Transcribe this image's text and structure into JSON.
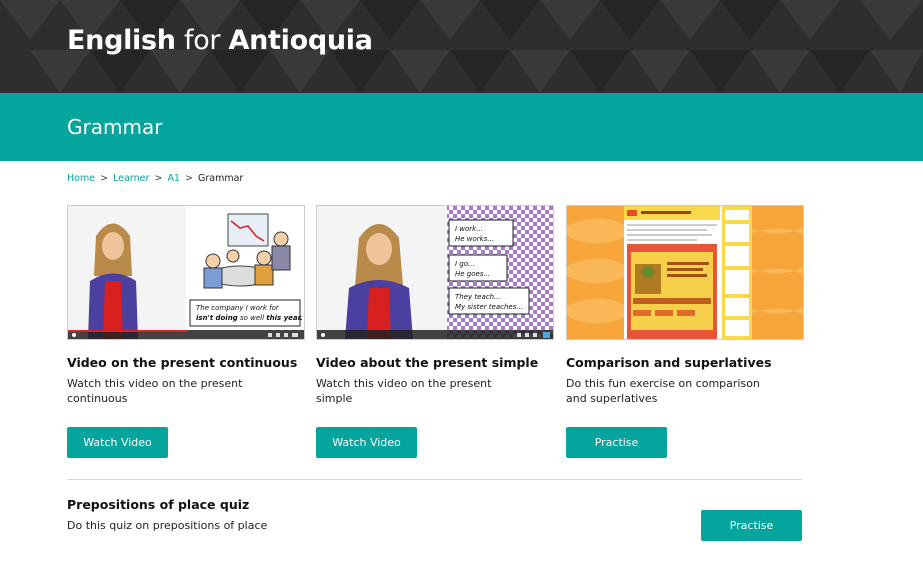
{
  "header": {
    "brand_part1": "English",
    "brand_part2": "for",
    "brand_part3": "Antioquia"
  },
  "section": {
    "title": "Grammar"
  },
  "breadcrumb": {
    "items": [
      "Home",
      "Learner",
      "A1"
    ],
    "current": "Grammar",
    "separator": ">"
  },
  "cards": [
    {
      "title": "Video on the present continuous",
      "description": "Watch this video on the present continuous",
      "button": "Watch Video",
      "thumb_caption_1": "The company I work for",
      "thumb_caption_2": "isn't doing",
      "thumb_caption_3": "so well",
      "thumb_caption_4": "this year."
    },
    {
      "title": "Video about the present simple",
      "description": "Watch this video on the present simple",
      "button": "Watch Video",
      "bubble_1a": "I work...",
      "bubble_1b": "He works...",
      "bubble_2a": "I go...",
      "bubble_2b": "He goes...",
      "bubble_3a": "They teach...",
      "bubble_3b": "My sister teaches..."
    },
    {
      "title": "Comparison and superlatives",
      "description": "Do this fun exercise on comparison and superlatives",
      "button": "Practise"
    }
  ],
  "quiz": {
    "title": "Prepositions of place quiz",
    "description": "Do this quiz on prepositions of place",
    "button": "Practise"
  },
  "colors": {
    "accent": "#04a59d",
    "header_bg": "#2e2e2e"
  }
}
